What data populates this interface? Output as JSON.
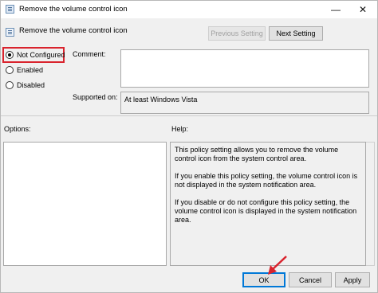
{
  "window": {
    "title": "Remove the volume control icon",
    "minimize_glyph": "—",
    "close_glyph": "✕"
  },
  "header": {
    "policy_name": "Remove the volume control icon",
    "previous_label": "Previous Setting",
    "next_label": "Next Setting"
  },
  "state": {
    "options": [
      {
        "label": "Not Configured",
        "checked": true
      },
      {
        "label": "Enabled",
        "checked": false
      },
      {
        "label": "Disabled",
        "checked": false
      }
    ]
  },
  "comment": {
    "label": "Comment:",
    "value": ""
  },
  "supported": {
    "label": "Supported on:",
    "value": "At least Windows Vista"
  },
  "options_pane": {
    "label": "Options:"
  },
  "help_pane": {
    "label": "Help:",
    "paragraphs": [
      "This policy setting allows you to remove the volume control icon from the system control area.",
      "If you enable this policy setting, the volume control icon is not displayed in the system notification area.",
      "If you disable or do not configure this policy setting, the volume control icon is displayed in the system notification area."
    ]
  },
  "footer": {
    "ok_label": "OK",
    "cancel_label": "Cancel",
    "apply_label": "Apply"
  },
  "colors": {
    "highlight": "#d9232d",
    "accent": "#0078d7"
  },
  "icons": [
    "app-icon",
    "policy-icon",
    "minimize-icon",
    "close-icon",
    "radio-icon",
    "annotation-arrow-icon"
  ]
}
